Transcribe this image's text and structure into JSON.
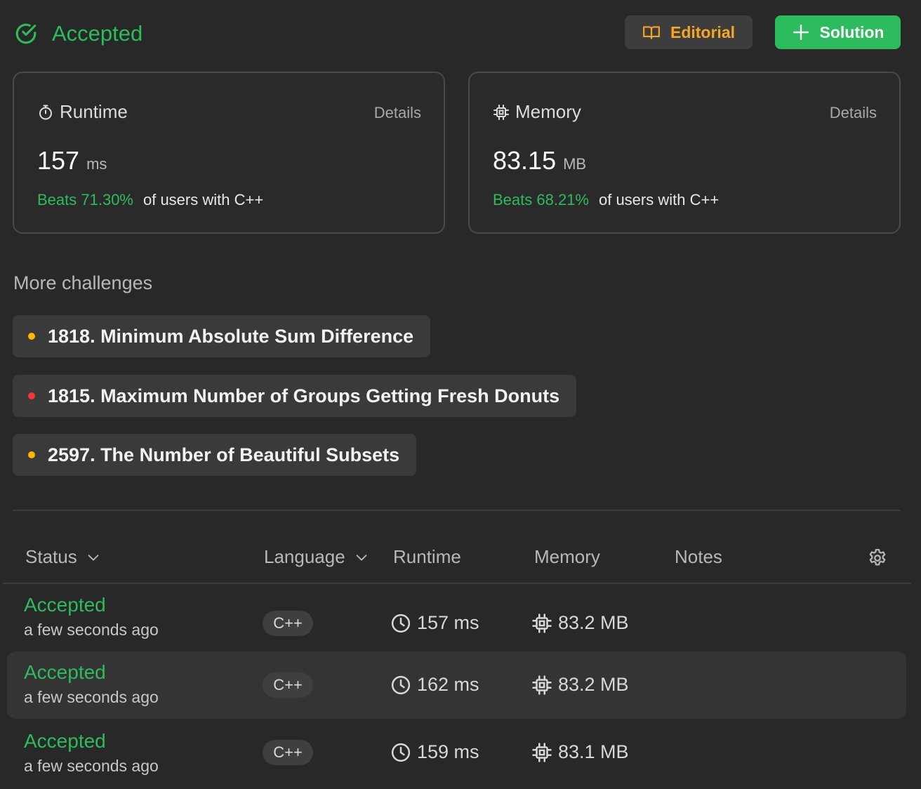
{
  "header": {
    "status": "Accepted",
    "editorial_label": "Editorial",
    "solution_label": "Solution"
  },
  "runtime_card": {
    "title": "Runtime",
    "details": "Details",
    "value": "157",
    "unit": "ms",
    "beats": "Beats 71.30%",
    "beats_suffix": "of users with C++"
  },
  "memory_card": {
    "title": "Memory",
    "details": "Details",
    "value": "83.15",
    "unit": "MB",
    "beats": "Beats 68.21%",
    "beats_suffix": "of users with C++"
  },
  "challenges": {
    "title": "More challenges",
    "items": [
      {
        "label": "1818. Minimum Absolute Sum Difference",
        "difficulty_color": "#ffb800"
      },
      {
        "label": "1815. Maximum Number of Groups Getting Fresh Donuts",
        "difficulty_color": "#f63636"
      },
      {
        "label": "2597. The Number of Beautiful Subsets",
        "difficulty_color": "#ffb800"
      }
    ]
  },
  "table": {
    "headers": {
      "status": "Status",
      "language": "Language",
      "runtime": "Runtime",
      "memory": "Memory",
      "notes": "Notes"
    },
    "rows": [
      {
        "status": "Accepted",
        "time": "a few seconds ago",
        "language": "C++",
        "runtime": "157 ms",
        "memory": "83.2 MB"
      },
      {
        "status": "Accepted",
        "time": "a few seconds ago",
        "language": "C++",
        "runtime": "162 ms",
        "memory": "83.2 MB"
      },
      {
        "status": "Accepted",
        "time": "a few seconds ago",
        "language": "C++",
        "runtime": "159 ms",
        "memory": "83.1 MB"
      }
    ]
  },
  "colors": {
    "accent_green": "#2cbb5d",
    "editorial_orange": "#f5a623",
    "background": "#282828"
  },
  "icons": [
    "check-circle-icon",
    "book-icon",
    "plus-icon",
    "timer-icon",
    "chip-icon",
    "chevron-down-icon",
    "gear-icon",
    "clock-icon"
  ]
}
